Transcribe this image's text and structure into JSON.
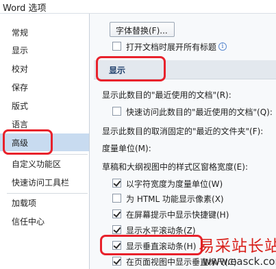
{
  "window": {
    "title": "Word 选项"
  },
  "sidebar": {
    "items": [
      {
        "label": "常规"
      },
      {
        "label": "显示"
      },
      {
        "label": "校对"
      },
      {
        "label": "保存"
      },
      {
        "label": "版式"
      },
      {
        "label": "语言"
      },
      {
        "label": "高级",
        "selected": true
      },
      {
        "label": "自定义功能区"
      },
      {
        "label": "快速访问工具栏"
      },
      {
        "label": "加载项"
      },
      {
        "label": "信任中心"
      }
    ]
  },
  "content": {
    "font_substitution_button": "字体替换(F)...",
    "open_all_headings_label": "打开文档时展开所有标题",
    "info_icon": "i",
    "section_title": "显示",
    "recent_docs_count_label": "显示此数目的\"最近使用的文档\"(R):",
    "quick_access_recent_label": "快速访问此数目的\"最近使用的文档\"(Q):",
    "unpinned_folders_label": "显示此数目的取消固定的\"最近的文件夹\"(F):",
    "measure_units_label": "度量单位(M):",
    "style_area_width_label": "草稿和大纲视图中的样式区窗格宽度(E):",
    "options": [
      {
        "label": "以字符宽度为度量单位(W)",
        "checked": true
      },
      {
        "label": "为 HTML 功能显示像素(X)",
        "checked": false
      },
      {
        "label": "在屏幕提示中显示快捷键(H)",
        "checked": true
      },
      {
        "label": "显示水平滚动条(Z)",
        "checked": true
      },
      {
        "label": "显示垂直滚动条(H)",
        "checked": true
      },
      {
        "label": "在页面视图中显示垂直标尺(C)",
        "checked": true
      }
    ]
  },
  "watermark": {
    "title": "易采站长站",
    "url": "www.easck.com"
  },
  "colors": {
    "highlight": "#e8212b",
    "selected_nav": "#c8dbf0",
    "content_bg": "#f7f9fb",
    "section_bg": "#e3e8ee"
  }
}
